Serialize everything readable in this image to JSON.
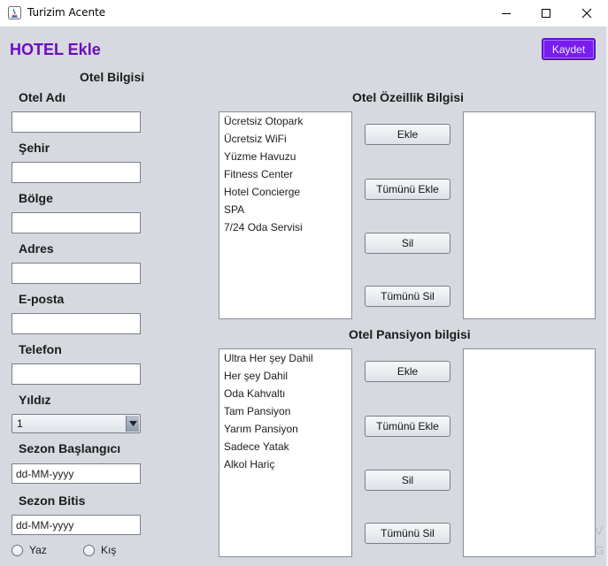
{
  "window": {
    "title": "Turizim Acente",
    "minimize_icon": "minimize-icon",
    "maximize_icon": "maximize-icon",
    "close_icon": "close-icon"
  },
  "header": {
    "title": "HOTEL Ekle",
    "save_label": "Kaydet"
  },
  "hotel_info": {
    "section_title": "Otel Bilgisi",
    "fields": [
      {
        "label": "Otel Adı",
        "value": ""
      },
      {
        "label": "Şehir",
        "value": ""
      },
      {
        "label": "Bölge",
        "value": ""
      },
      {
        "label": "Adres",
        "value": ""
      },
      {
        "label": "E-posta",
        "value": ""
      },
      {
        "label": "Telefon",
        "value": ""
      }
    ],
    "stars": {
      "label": "Yıldız",
      "selected": "1"
    },
    "season_start": {
      "label": "Sezon Başlangıcı",
      "value": "dd-MM-yyyy"
    },
    "season_end": {
      "label": "Sezon Bitis",
      "value": "dd-MM-yyyy"
    },
    "season_options": [
      "Yaz",
      "Kış"
    ]
  },
  "features": {
    "section_title": "Otel Özeillik Bilgisi",
    "items": [
      "Ücretsiz Otopark",
      "Ücretsiz WiFi",
      "Yüzme Havuzu",
      "Fitness Center",
      "Hotel Concierge",
      "SPA",
      "7/24 Oda Servisi"
    ],
    "buttons": [
      "Ekle",
      "Tümünü Ekle",
      "Sil",
      "Tümünü Sil"
    ]
  },
  "pension": {
    "section_title": "Otel Pansiyon bilgisi",
    "items": [
      "Ultra Her şey Dahil",
      "Her şey Dahil",
      "Oda Kahvaltı",
      "Tam Pansiyon",
      "Yarım Pansiyon",
      "Sadece Yatak",
      "Alkol Hariç"
    ],
    "buttons": [
      "Ekle",
      "Tümünü Ekle",
      "Sil",
      "Tümünü Sil"
    ]
  },
  "colors": {
    "accent": "#6b0dbf",
    "save_button_bg": "#7a1cf0",
    "panel_bg": "#d6d9df"
  }
}
